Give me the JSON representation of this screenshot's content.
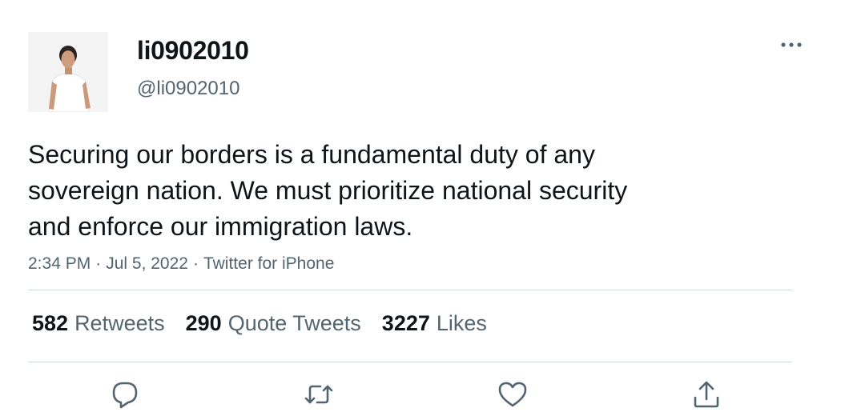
{
  "user": {
    "display_name": "li0902010",
    "handle": "@li0902010",
    "avatar_icon": "profile-photo"
  },
  "tweet": {
    "text": "Securing our borders is a fundamental duty of any\nsovereign nation. We must prioritize national security\nand enforce our immigration laws.",
    "time": "2:34 PM",
    "date": "Jul 5, 2022",
    "source": "Twitter for iPhone",
    "separator": "·"
  },
  "stats": {
    "retweets": {
      "count": "582",
      "label": "Retweets"
    },
    "quotes": {
      "count": "290",
      "label": "Quote Tweets"
    },
    "likes": {
      "count": "3227",
      "label": "Likes"
    }
  },
  "actions": {
    "reply_icon": "reply-icon",
    "retweet_icon": "retweet-icon",
    "like_icon": "heart-icon",
    "share_icon": "share-icon"
  },
  "colors": {
    "text": "#0f1419",
    "secondary": "#536471",
    "divider": "#cfd9de",
    "icon": "#536471"
  }
}
